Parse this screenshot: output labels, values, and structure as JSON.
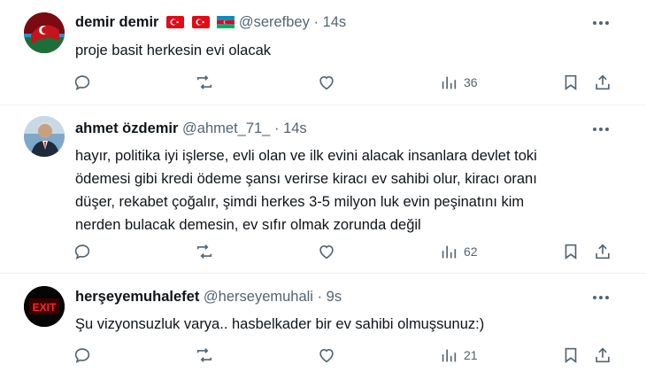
{
  "tweets": [
    {
      "name": "demir demir",
      "handle": "@serefbey",
      "time": "14s",
      "flags": [
        "turkey-flag",
        "turkey-flag",
        "azerbaijan-flag"
      ],
      "text": "proje basit herkesin evi olacak",
      "views": "36",
      "replies": "",
      "reposts": "",
      "likes": ""
    },
    {
      "name": "ahmet özdemir",
      "handle": "@ahmet_71_",
      "time": "14s",
      "text_lines": [
        "hayır, politika iyi işlerse, evli olan ve ilk evini alacak insanlara devlet toki",
        "ödemesi gibi kredi ödeme şansı verirse kiracı ev sahibi olur, kiracı oranı",
        "düşer, rekabet çoğalır, şimdi herkes 3-5 milyon luk evin peşinatını kim",
        "nerden bulacak demesin, ev sıfır olmak zorunda değil"
      ],
      "views": "62"
    },
    {
      "name": "herşeyemuhalefet",
      "handle": "@herseyemuhali",
      "time": "9s",
      "text": "Şu vizyonsuzluk varya.. hasbelkader bir ev sahibi olmuşsunuz:)",
      "views": "21",
      "avatar_text": "EXIT"
    }
  ],
  "separator": "·",
  "colors": {
    "text": "#0f1419",
    "secondary": "#536471",
    "divider": "#eff3f4"
  },
  "icons": [
    "reply-icon",
    "repost-icon",
    "like-icon",
    "views-icon",
    "bookmark-icon",
    "share-icon",
    "more-icon"
  ]
}
